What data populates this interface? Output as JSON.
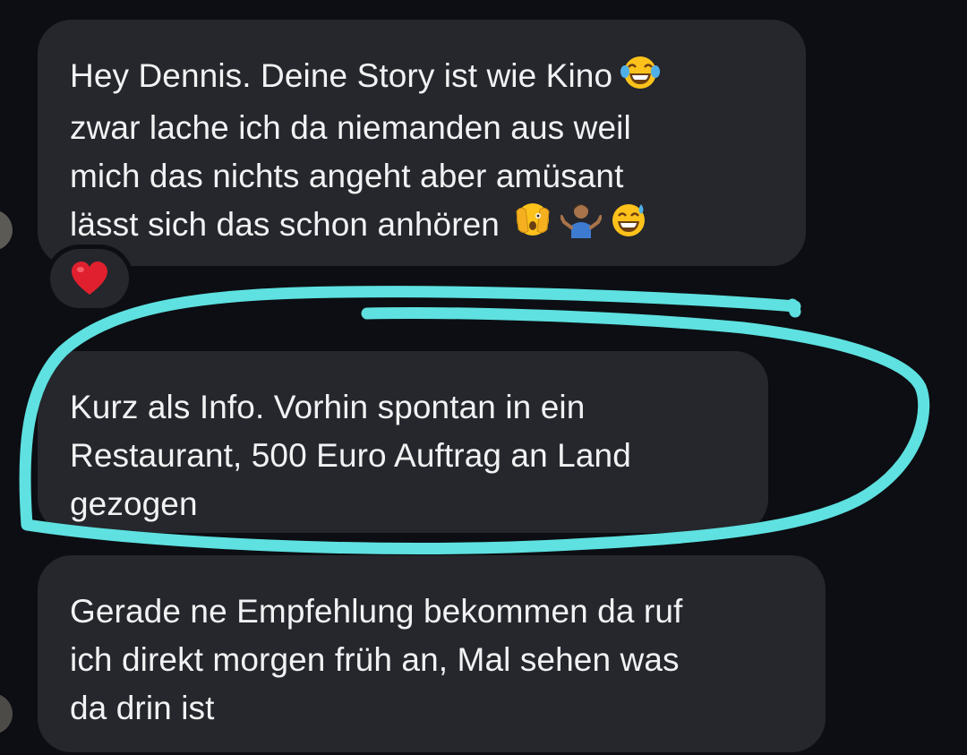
{
  "conversation": {
    "messages": [
      {
        "lines": [
          "Hey Dennis. Deine Story ist wie Kino",
          "zwar lache ich da niemanden aus weil",
          "mich das nichts angeht aber amüsant",
          "lässt sich das schon anhören"
        ],
        "emojis_line1": [
          "face-with-tears-of-joy-emoji"
        ],
        "emojis_line4": [
          "face-with-open-eyes-and-hand-over-mouth-emoji",
          "person-shrugging-emoji",
          "grinning-face-with-sweat-emoji"
        ],
        "reaction": "red-heart-emoji"
      },
      {
        "lines": [
          "Kurz als Info. Vorhin spontan in ein",
          "Restaurant, 500 Euro Auftrag an Land",
          "gezogen"
        ],
        "highlighted": true
      },
      {
        "lines": [
          "Gerade ne Empfehlung bekommen da ruf",
          "ich direkt morgen früh an, Mal sehen was",
          "da drin ist"
        ]
      }
    ]
  },
  "colors": {
    "background": "#0c0e13",
    "bubble": "#25272d",
    "text": "#f2f2f4",
    "highlight_stroke": "#5ee1e0",
    "heart": "#e0202e"
  }
}
